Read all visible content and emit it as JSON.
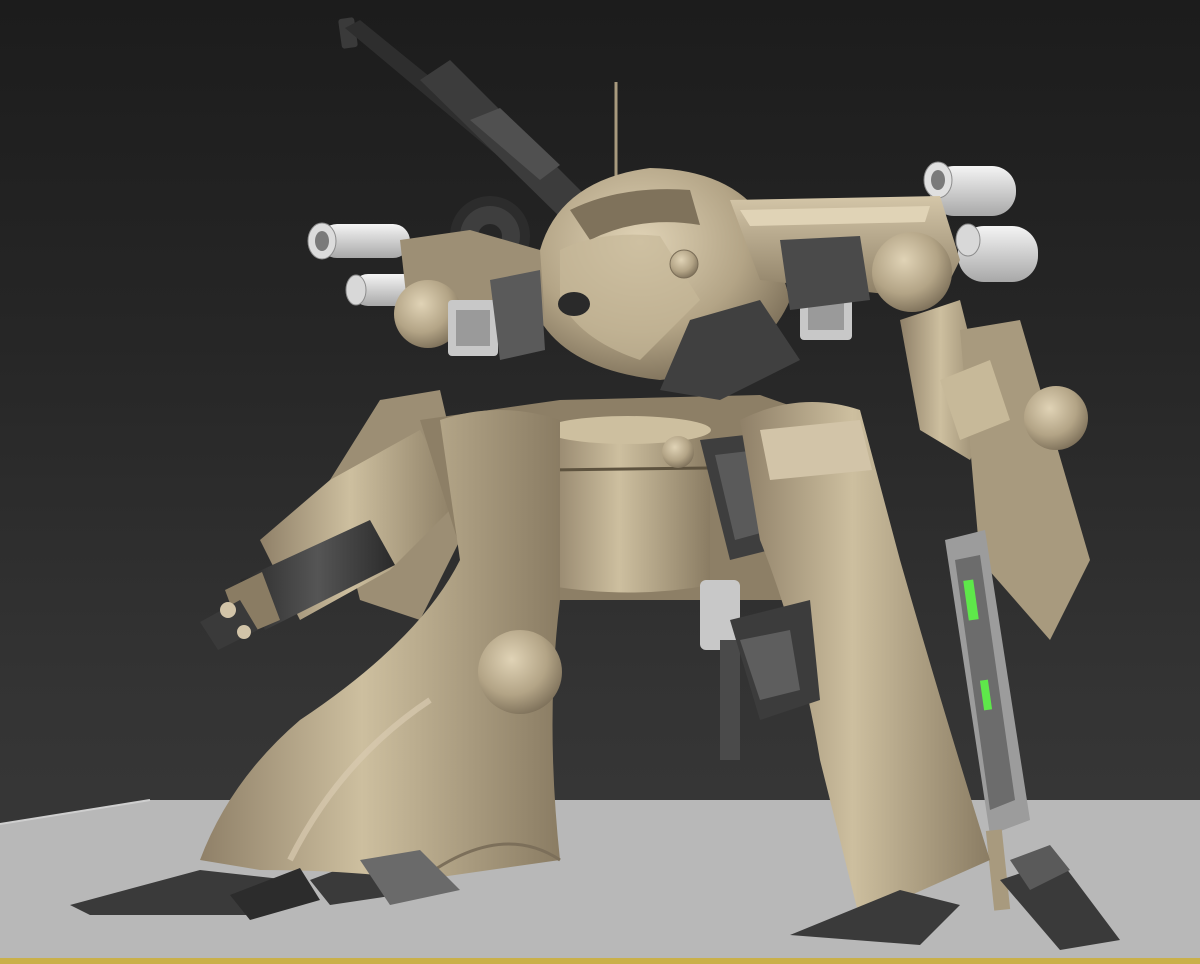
{
  "scene": {
    "subject": "mech-robot",
    "colors": {
      "body": "#b8a88c",
      "body_light": "#d2c4a8",
      "body_shadow": "#7c6f5a",
      "joint": "#9a8c72",
      "dark_metal": "#3a3a3a",
      "weapon": "#2e2e2e",
      "exhaust": "#e2e2e2",
      "ground": "#b7b7b7",
      "accent_green": "#5ee84a",
      "background_top": "#1c1c1c",
      "background_bottom": "#3a3a3a"
    }
  }
}
